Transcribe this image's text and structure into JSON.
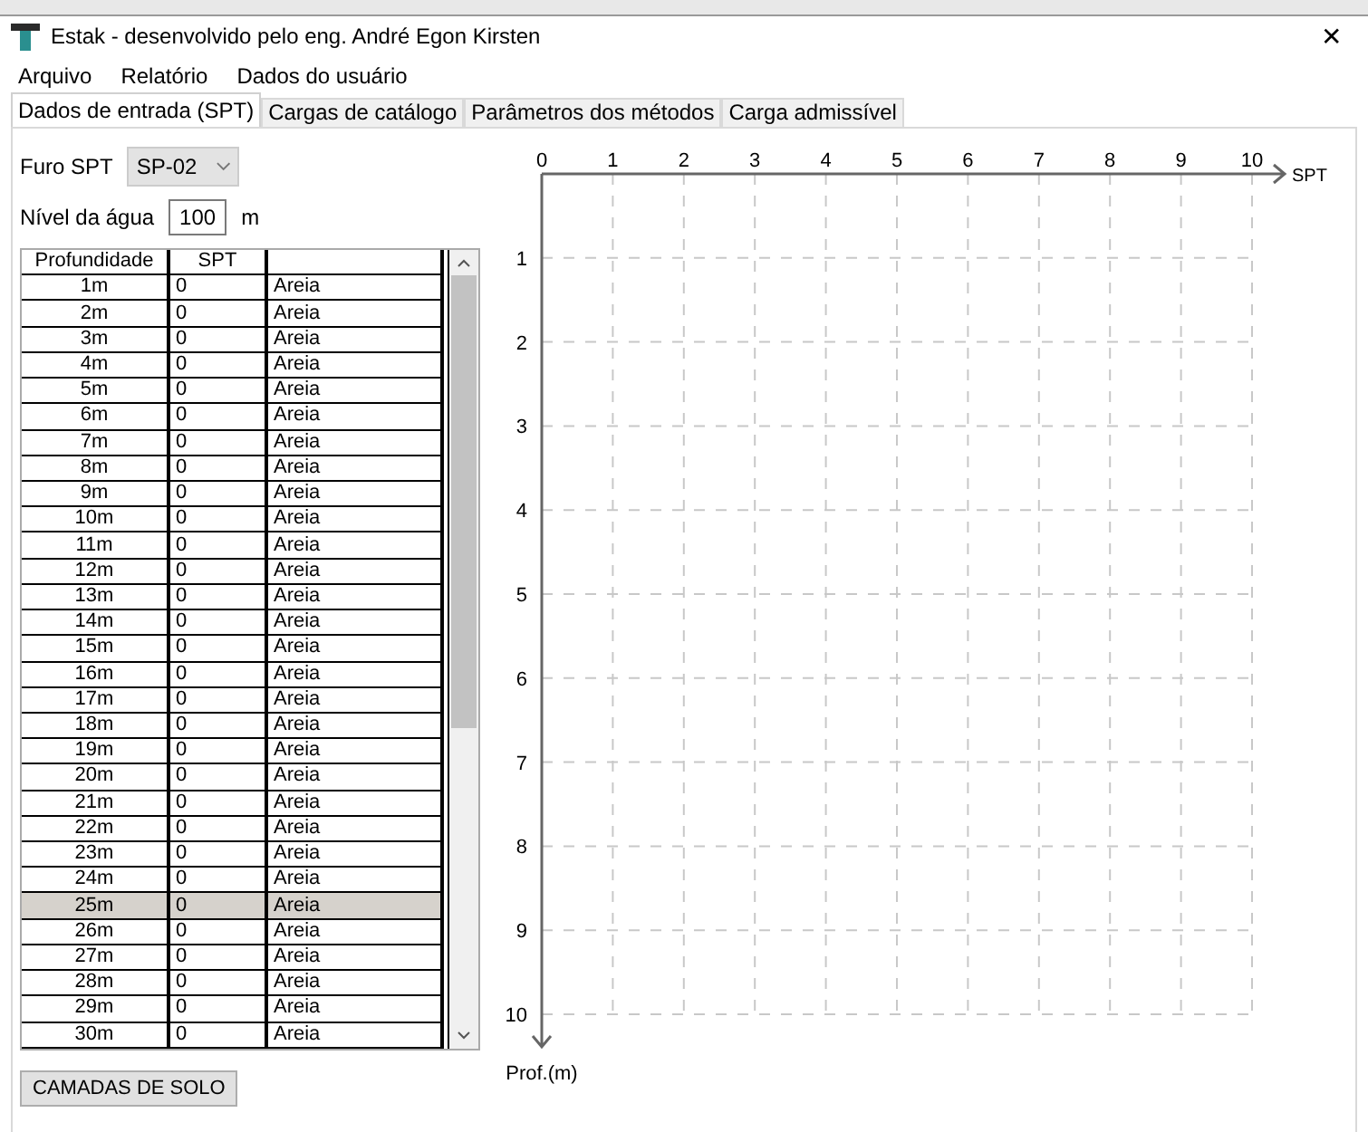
{
  "window": {
    "title": "Estak - desenvolvido pelo eng. André Egon Kirsten",
    "close": "✕"
  },
  "menu": [
    "Arquivo",
    "Relatório",
    "Dados do usuário"
  ],
  "tabs": [
    {
      "label": "Dados de entrada (SPT)",
      "selected": true
    },
    {
      "label": "Cargas de catálogo",
      "selected": false
    },
    {
      "label": "Parâmetros dos métodos",
      "selected": false
    },
    {
      "label": "Carga admissível",
      "selected": false
    }
  ],
  "furo": {
    "label": "Furo SPT",
    "value": "SP-02"
  },
  "water": {
    "label": "Nível da água",
    "value": "100",
    "unit": "m"
  },
  "table": {
    "columns": [
      "Profundidade",
      "SPT"
    ],
    "rows": [
      {
        "depth": "1m",
        "spt": "0",
        "soil": "Areia",
        "selected": false
      },
      {
        "depth": "2m",
        "spt": "0",
        "soil": "Areia",
        "selected": false
      },
      {
        "depth": "3m",
        "spt": "0",
        "soil": "Areia",
        "selected": false
      },
      {
        "depth": "4m",
        "spt": "0",
        "soil": "Areia",
        "selected": false
      },
      {
        "depth": "5m",
        "spt": "0",
        "soil": "Areia",
        "selected": false
      },
      {
        "depth": "6m",
        "spt": "0",
        "soil": "Areia",
        "selected": false
      },
      {
        "depth": "7m",
        "spt": "0",
        "soil": "Areia",
        "selected": false
      },
      {
        "depth": "8m",
        "spt": "0",
        "soil": "Areia",
        "selected": false
      },
      {
        "depth": "9m",
        "spt": "0",
        "soil": "Areia",
        "selected": false
      },
      {
        "depth": "10m",
        "spt": "0",
        "soil": "Areia",
        "selected": false
      },
      {
        "depth": "11m",
        "spt": "0",
        "soil": "Areia",
        "selected": false
      },
      {
        "depth": "12m",
        "spt": "0",
        "soil": "Areia",
        "selected": false
      },
      {
        "depth": "13m",
        "spt": "0",
        "soil": "Areia",
        "selected": false
      },
      {
        "depth": "14m",
        "spt": "0",
        "soil": "Areia",
        "selected": false
      },
      {
        "depth": "15m",
        "spt": "0",
        "soil": "Areia",
        "selected": false
      },
      {
        "depth": "16m",
        "spt": "0",
        "soil": "Areia",
        "selected": false
      },
      {
        "depth": "17m",
        "spt": "0",
        "soil": "Areia",
        "selected": false
      },
      {
        "depth": "18m",
        "spt": "0",
        "soil": "Areia",
        "selected": false
      },
      {
        "depth": "19m",
        "spt": "0",
        "soil": "Areia",
        "selected": false
      },
      {
        "depth": "20m",
        "spt": "0",
        "soil": "Areia",
        "selected": false
      },
      {
        "depth": "21m",
        "spt": "0",
        "soil": "Areia",
        "selected": false
      },
      {
        "depth": "22m",
        "spt": "0",
        "soil": "Areia",
        "selected": false
      },
      {
        "depth": "23m",
        "spt": "0",
        "soil": "Areia",
        "selected": false
      },
      {
        "depth": "24m",
        "spt": "0",
        "soil": "Areia",
        "selected": false
      },
      {
        "depth": "25m",
        "spt": "0",
        "soil": "Areia",
        "selected": true
      },
      {
        "depth": "26m",
        "spt": "0",
        "soil": "Areia",
        "selected": false
      },
      {
        "depth": "27m",
        "spt": "0",
        "soil": "Areia",
        "selected": false
      },
      {
        "depth": "28m",
        "spt": "0",
        "soil": "Areia",
        "selected": false
      },
      {
        "depth": "29m",
        "spt": "0",
        "soil": "Areia",
        "selected": false
      },
      {
        "depth": "30m",
        "spt": "0",
        "soil": "Areia",
        "selected": false
      }
    ]
  },
  "layers_button": "CAMADAS DE SOLO",
  "chart": {
    "chart_data": {
      "type": "scatter",
      "grid": true,
      "xlabel": "SPT",
      "ylabel": "Prof.(m)",
      "xlim": [
        0,
        10
      ],
      "ylim": [
        10,
        0
      ],
      "xticks": [
        0,
        1,
        2,
        3,
        4,
        5,
        6,
        7,
        8,
        9,
        10
      ],
      "yticks": [
        1,
        2,
        3,
        4,
        5,
        6,
        7,
        8,
        9,
        10
      ]
    }
  }
}
